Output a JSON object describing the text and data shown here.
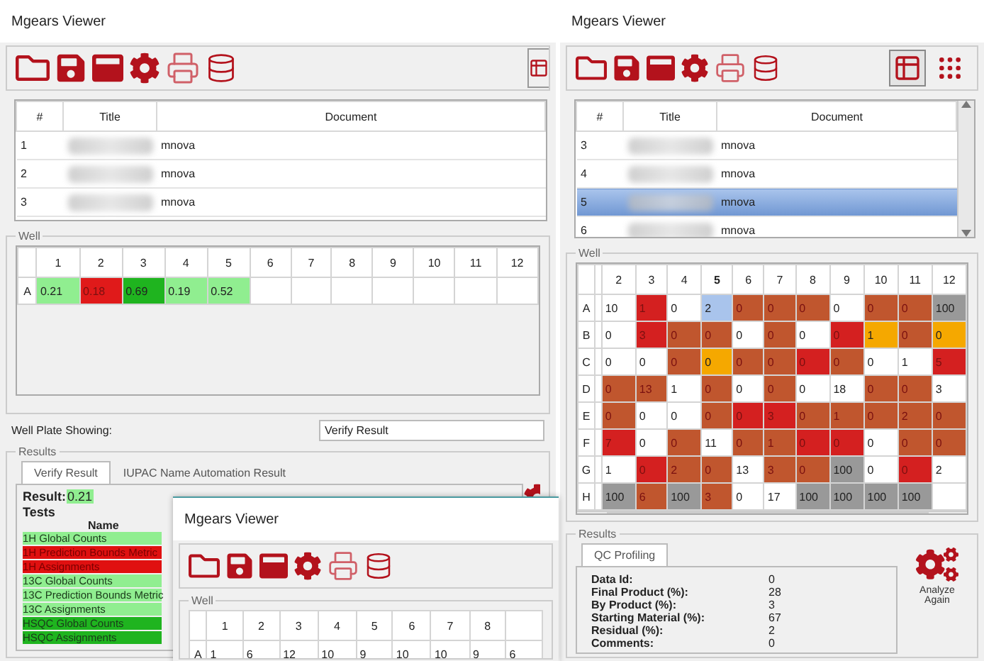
{
  "left_window": {
    "title": "Mgears Viewer",
    "documents": {
      "columns": [
        "#",
        "Title",
        "Document"
      ],
      "rows": [
        {
          "number": "1",
          "document": "mnova"
        },
        {
          "number": "2",
          "document": "mnova"
        },
        {
          "number": "3",
          "document": "mnova"
        }
      ]
    },
    "well": {
      "legend": "Well",
      "columns": [
        "1",
        "2",
        "3",
        "4",
        "5",
        "6",
        "7",
        "8",
        "9",
        "10",
        "11",
        "12"
      ],
      "rows": [
        {
          "label": "A",
          "cells": [
            {
              "value": "0.21",
              "color": "#90ee90"
            },
            {
              "value": "0.18",
              "color": "#e01a1a"
            },
            {
              "value": "0.69",
              "color": "#1fb41f"
            },
            {
              "value": "0.19",
              "color": "#90ee90"
            },
            {
              "value": "0.52",
              "color": "#90ee90"
            }
          ]
        }
      ]
    },
    "plate_showing": {
      "label": "Well Plate Showing:",
      "value": "Verify Result"
    },
    "results": {
      "legend": "Results",
      "tabs": [
        {
          "label": "Verify Result",
          "selected": true
        },
        {
          "label": "IUPAC Name Automation Result",
          "selected": false
        }
      ],
      "result": {
        "label": "Result:",
        "value": "0.21",
        "color": "#90ee90"
      },
      "tests_title": "Tests",
      "name_header": "Name",
      "tests": [
        {
          "name": "1H Global Counts",
          "color": "#90ee90"
        },
        {
          "name": "1H Prediction Bounds Metric",
          "color": "#e01010"
        },
        {
          "name": "1H Assignments",
          "color": "#e01010"
        },
        {
          "name": "13C Global Counts",
          "color": "#90ee90"
        },
        {
          "name": "13C Prediction Bounds Metric",
          "color": "#90ee90"
        },
        {
          "name": "13C Assignments",
          "color": "#90ee90"
        },
        {
          "name": "HSQC Global Counts",
          "color": "#1fb41f"
        },
        {
          "name": "HSQC Assignments",
          "color": "#1fb41f"
        }
      ]
    }
  },
  "right_window": {
    "title": "Mgears Viewer",
    "view_toggles": [
      {
        "kind": "table",
        "selected": true
      },
      {
        "kind": "plate",
        "selected": false
      }
    ],
    "documents": {
      "columns": [
        "#",
        "Title",
        "Document"
      ],
      "rows": [
        {
          "number": "3",
          "document": "mnova",
          "selected": false
        },
        {
          "number": "4",
          "document": "mnova",
          "selected": false
        },
        {
          "number": "5",
          "document": "mnova",
          "selected": true
        },
        {
          "number": "6",
          "document": "mnova",
          "selected": false
        }
      ]
    },
    "well": {
      "legend": "Well",
      "columns": [
        {
          "label": "2",
          "selected": false
        },
        {
          "label": "3",
          "selected": false
        },
        {
          "label": "4",
          "selected": false
        },
        {
          "label": "5",
          "selected": true
        },
        {
          "label": "6",
          "selected": false
        },
        {
          "label": "7",
          "selected": false
        },
        {
          "label": "8",
          "selected": false
        },
        {
          "label": "9",
          "selected": false
        },
        {
          "label": "10",
          "selected": false
        },
        {
          "label": "11",
          "selected": false
        },
        {
          "label": "12",
          "selected": false
        }
      ],
      "rows": [
        {
          "label": "A",
          "cells": [
            {
              "value": "10",
              "color": "#ffffff"
            },
            {
              "value": "1",
              "color": "#d42020"
            },
            {
              "value": "0",
              "color": "#ffffff"
            },
            {
              "value": "2",
              "color": "#a9c4ec"
            },
            {
              "value": "0",
              "color": "#c0562e"
            },
            {
              "value": "0",
              "color": "#c0562e"
            },
            {
              "value": "0",
              "color": "#c0562e"
            },
            {
              "value": "0",
              "color": "#ffffff"
            },
            {
              "value": "0",
              "color": "#c0562e"
            },
            {
              "value": "0",
              "color": "#c0562e"
            },
            {
              "value": "100",
              "color": "#999999"
            }
          ]
        },
        {
          "label": "B",
          "cells": [
            {
              "value": "0",
              "color": "#ffffff"
            },
            {
              "value": "3",
              "color": "#d42020"
            },
            {
              "value": "0",
              "color": "#c0562e"
            },
            {
              "value": "0",
              "color": "#c0562e"
            },
            {
              "value": "0",
              "color": "#ffffff"
            },
            {
              "value": "0",
              "color": "#c0562e"
            },
            {
              "value": "0",
              "color": "#ffffff"
            },
            {
              "value": "0",
              "color": "#d42020"
            },
            {
              "value": "1",
              "color": "#f5a800"
            },
            {
              "value": "0",
              "color": "#c0562e"
            },
            {
              "value": "0",
              "color": "#f5a800"
            }
          ]
        },
        {
          "label": "C",
          "cells": [
            {
              "value": "0",
              "color": "#ffffff"
            },
            {
              "value": "0",
              "color": "#ffffff"
            },
            {
              "value": "0",
              "color": "#c0562e"
            },
            {
              "value": "0",
              "color": "#f5a800"
            },
            {
              "value": "0",
              "color": "#c0562e"
            },
            {
              "value": "0",
              "color": "#c0562e"
            },
            {
              "value": "0",
              "color": "#d42020"
            },
            {
              "value": "0",
              "color": "#c0562e"
            },
            {
              "value": "0",
              "color": "#ffffff"
            },
            {
              "value": "1",
              "color": "#ffffff"
            },
            {
              "value": "5",
              "color": "#d42020"
            }
          ]
        },
        {
          "label": "D",
          "cells": [
            {
              "value": "0",
              "color": "#c0562e"
            },
            {
              "value": "13",
              "color": "#c0562e"
            },
            {
              "value": "1",
              "color": "#ffffff"
            },
            {
              "value": "0",
              "color": "#c0562e"
            },
            {
              "value": "0",
              "color": "#ffffff"
            },
            {
              "value": "0",
              "color": "#c0562e"
            },
            {
              "value": "0",
              "color": "#ffffff"
            },
            {
              "value": "18",
              "color": "#ffffff"
            },
            {
              "value": "0",
              "color": "#c0562e"
            },
            {
              "value": "0",
              "color": "#c0562e"
            },
            {
              "value": "3",
              "color": "#ffffff"
            }
          ]
        },
        {
          "label": "E",
          "cells": [
            {
              "value": "0",
              "color": "#c0562e"
            },
            {
              "value": "0",
              "color": "#ffffff"
            },
            {
              "value": "0",
              "color": "#ffffff"
            },
            {
              "value": "0",
              "color": "#c0562e"
            },
            {
              "value": "0",
              "color": "#d42020"
            },
            {
              "value": "3",
              "color": "#d42020"
            },
            {
              "value": "0",
              "color": "#c0562e"
            },
            {
              "value": "1",
              "color": "#c0562e"
            },
            {
              "value": "0",
              "color": "#c0562e"
            },
            {
              "value": "2",
              "color": "#c0562e"
            },
            {
              "value": "0",
              "color": "#c0562e"
            }
          ]
        },
        {
          "label": "F",
          "cells": [
            {
              "value": "7",
              "color": "#d42020"
            },
            {
              "value": "0",
              "color": "#ffffff"
            },
            {
              "value": "0",
              "color": "#c0562e"
            },
            {
              "value": "11",
              "color": "#ffffff"
            },
            {
              "value": "0",
              "color": "#c0562e"
            },
            {
              "value": "1",
              "color": "#c0562e"
            },
            {
              "value": "0",
              "color": "#d42020"
            },
            {
              "value": "0",
              "color": "#d42020"
            },
            {
              "value": "0",
              "color": "#ffffff"
            },
            {
              "value": "0",
              "color": "#c0562e"
            },
            {
              "value": "0",
              "color": "#c0562e"
            }
          ]
        },
        {
          "label": "G",
          "cells": [
            {
              "value": "1",
              "color": "#ffffff"
            },
            {
              "value": "0",
              "color": "#d42020"
            },
            {
              "value": "2",
              "color": "#c0562e"
            },
            {
              "value": "0",
              "color": "#c0562e"
            },
            {
              "value": "13",
              "color": "#ffffff"
            },
            {
              "value": "3",
              "color": "#c0562e"
            },
            {
              "value": "0",
              "color": "#c0562e"
            },
            {
              "value": "100",
              "color": "#999999"
            },
            {
              "value": "0",
              "color": "#ffffff"
            },
            {
              "value": "0",
              "color": "#d42020"
            },
            {
              "value": "2",
              "color": "#ffffff"
            }
          ]
        },
        {
          "label": "H",
          "cells": [
            {
              "value": "100",
              "color": "#999999"
            },
            {
              "value": "6",
              "color": "#c0562e"
            },
            {
              "value": "100",
              "color": "#999999"
            },
            {
              "value": "3",
              "color": "#c0562e"
            },
            {
              "value": "0",
              "color": "#ffffff"
            },
            {
              "value": "17",
              "color": "#ffffff"
            },
            {
              "value": "100",
              "color": "#999999"
            },
            {
              "value": "100",
              "color": "#999999"
            },
            {
              "value": "100",
              "color": "#999999"
            },
            {
              "value": "100",
              "color": "#999999"
            },
            {
              "color": "#ffffff"
            }
          ]
        }
      ]
    },
    "results": {
      "legend": "Results",
      "tabs": [
        {
          "label": "QC Profiling",
          "selected": true
        }
      ],
      "fields": [
        {
          "label": "Data Id:",
          "value": "0"
        },
        {
          "label": "Final Product (%):",
          "value": "28"
        },
        {
          "label": "By Product (%):",
          "value": "3"
        },
        {
          "label": "Starting Material (%):",
          "value": "67"
        },
        {
          "label": "Residual (%):",
          "value": "2"
        },
        {
          "label": "Comments:",
          "value": "0"
        }
      ],
      "analyze_button": "Analyze Again"
    }
  },
  "front_window": {
    "title": "Mgears Viewer",
    "well": {
      "legend": "Well",
      "columns": [
        "1",
        "2",
        "3",
        "4",
        "5",
        "6",
        "7",
        "8"
      ],
      "rows": [
        {
          "label": "A",
          "cells": [
            "1",
            "6",
            "12",
            "10",
            "9",
            "10",
            "10",
            "9",
            "6"
          ]
        }
      ]
    }
  }
}
